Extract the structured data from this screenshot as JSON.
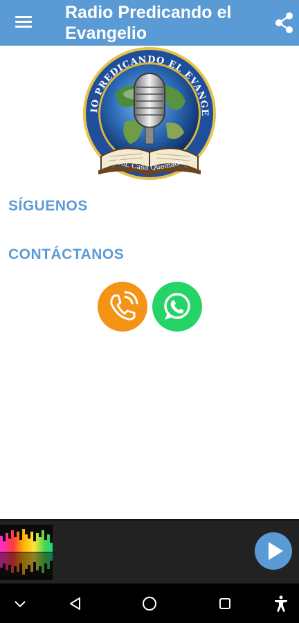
{
  "app": {
    "title": "Radio Predicando el Evangelio",
    "brand_color": "#5b9bd5",
    "menu_icon": "hamburger-menu-icon",
    "share_icon": "share-icon"
  },
  "logo": {
    "arc_text": "RADIO PREDICANDO EL EVANGELIO",
    "bottom_text": "Col. Casa Quemada",
    "icon": "radio-logo"
  },
  "sections": {
    "follow_label": "SÍGUENOS",
    "contact_label": "CONTÁCTANOS"
  },
  "contact_buttons": [
    {
      "name": "phone",
      "icon": "phone-icon",
      "color": "#f39416"
    },
    {
      "name": "whatsapp",
      "icon": "whatsapp-icon",
      "color": "#25d366"
    }
  ],
  "player": {
    "visualizer_icon": "equalizer-icon",
    "play_icon": "play-icon",
    "play_color": "#5b9bd5"
  },
  "system_nav": [
    "chevron-down-icon",
    "back-icon",
    "home-icon",
    "recents-icon",
    "accessibility-icon"
  ]
}
